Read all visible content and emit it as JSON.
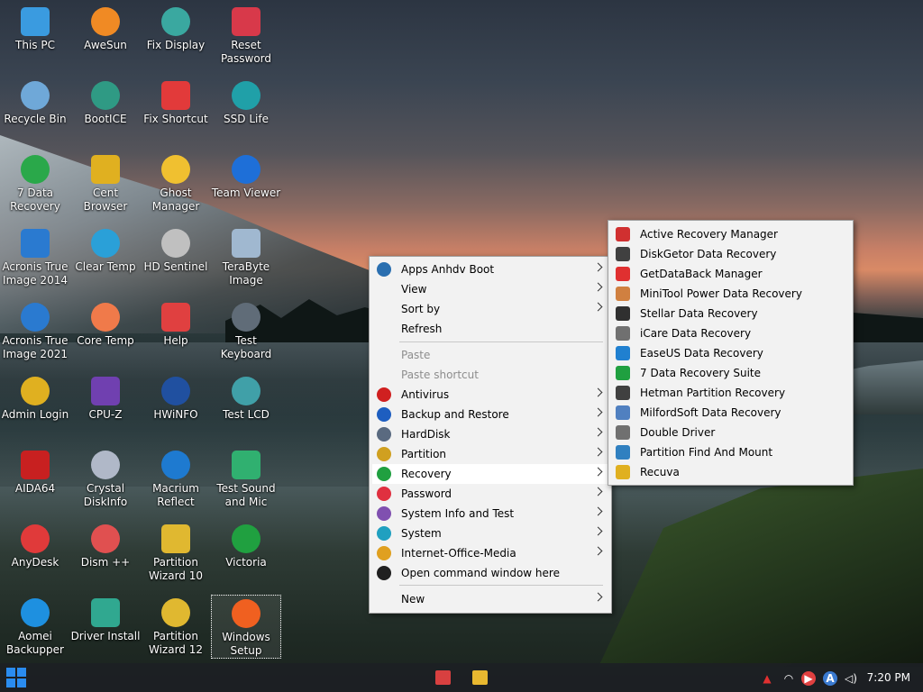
{
  "desktop": {
    "icons": [
      {
        "label": "This PC",
        "icon": "computer-icon",
        "color": "#3a9be0"
      },
      {
        "label": "AweSun",
        "icon": "awesun-icon",
        "color": "#f08a24"
      },
      {
        "label": "Fix Display",
        "icon": "fix-display-icon",
        "color": "#3aa8a0"
      },
      {
        "label": "Reset Password",
        "icon": "key-icon",
        "color": "#d8394a"
      },
      {
        "label": "Recycle Bin",
        "icon": "recycle-bin-icon",
        "color": "#6fa8d8"
      },
      {
        "label": "BootICE",
        "icon": "bootice-icon",
        "color": "#2f9a84"
      },
      {
        "label": "Fix Shortcut",
        "icon": "close-icon",
        "color": "#e23a3a"
      },
      {
        "label": "SSD Life",
        "icon": "ssd-icon",
        "color": "#20a0a8"
      },
      {
        "label": "7 Data Recovery",
        "icon": "recovery-icon",
        "color": "#2aa84a"
      },
      {
        "label": "Cent Browser",
        "icon": "browser-icon",
        "color": "#e0b020"
      },
      {
        "label": "Ghost Manager",
        "icon": "ghost-icon",
        "color": "#f0c030"
      },
      {
        "label": "Team Viewer",
        "icon": "teamviewer-icon",
        "color": "#1e6fd8"
      },
      {
        "label": "Acronis True Image 2014",
        "icon": "acronis-icon",
        "color": "#2a7ad0"
      },
      {
        "label": "Clear Temp",
        "icon": "broom-icon",
        "color": "#2aa0d8"
      },
      {
        "label": "HD Sentinel",
        "icon": "hdd-icon",
        "color": "#c0c0c0"
      },
      {
        "label": "TeraByte Image",
        "icon": "terabyte-icon",
        "color": "#a0b8d0"
      },
      {
        "label": "Acronis True Image 2021",
        "icon": "acronis-icon",
        "color": "#2a7ad0"
      },
      {
        "label": "Core Temp",
        "icon": "thermometer-icon",
        "color": "#f07a4a"
      },
      {
        "label": "Help",
        "icon": "lifebuoy-icon",
        "color": "#e04040"
      },
      {
        "label": "Test Keyboard",
        "icon": "keyboard-icon",
        "color": "#606c78"
      },
      {
        "label": "Admin Login",
        "icon": "shield-icon",
        "color": "#e0b020"
      },
      {
        "label": "CPU-Z",
        "icon": "cpu-icon",
        "color": "#7040b0"
      },
      {
        "label": "HWiNFO",
        "icon": "hwinfo-icon",
        "color": "#2050a0"
      },
      {
        "label": "Test LCD",
        "icon": "monitor-icon",
        "color": "#40a0a8"
      },
      {
        "label": "AIDA64",
        "icon": "aida-icon",
        "color": "#c82020"
      },
      {
        "label": "Crystal DiskInfo",
        "icon": "disk-icon",
        "color": "#b0b8c8"
      },
      {
        "label": "Macrium Reflect",
        "icon": "macrium-icon",
        "color": "#1e7ad0"
      },
      {
        "label": "Test Sound and Mic",
        "icon": "speaker-icon",
        "color": "#30b070"
      },
      {
        "label": "AnyDesk",
        "icon": "anydesk-icon",
        "color": "#e03a3a"
      },
      {
        "label": "Dism ++",
        "icon": "gear-icon",
        "color": "#e05050"
      },
      {
        "label": "Partition Wizard 10",
        "icon": "partition-icon",
        "color": "#e0b830"
      },
      {
        "label": "Victoria",
        "icon": "cross-icon",
        "color": "#20a040"
      },
      {
        "label": "Aomei Backupper",
        "icon": "backup-icon",
        "color": "#1e90e0"
      },
      {
        "label": "Driver Install",
        "icon": "wifi-icon",
        "color": "#30a890"
      },
      {
        "label": "Partition Wizard 12",
        "icon": "partition-icon",
        "color": "#e0b830"
      },
      {
        "label": "Windows Setup",
        "icon": "windows-icon",
        "color": "#f06020"
      }
    ]
  },
  "context_menu": {
    "items": [
      {
        "label": "Apps Anhdv Boot",
        "icon": "apps-icon",
        "color": "#2a6fb0",
        "arrow": true
      },
      {
        "label": "View",
        "icon": "",
        "arrow": true
      },
      {
        "label": "Sort by",
        "icon": "",
        "arrow": true
      },
      {
        "label": "Refresh",
        "icon": "",
        "arrow": false
      },
      {
        "label": "Paste",
        "icon": "",
        "arrow": false,
        "disabled": true
      },
      {
        "label": "Paste shortcut",
        "icon": "",
        "arrow": false,
        "disabled": true
      },
      {
        "label": "Antivirus",
        "icon": "antivirus-icon",
        "color": "#d02020",
        "arrow": true
      },
      {
        "label": "Backup and Restore",
        "icon": "backup-icon",
        "color": "#1e5ec0",
        "arrow": true
      },
      {
        "label": "HardDisk",
        "icon": "hdd-icon",
        "color": "#5a6a80",
        "arrow": true
      },
      {
        "label": "Partition",
        "icon": "partition-icon",
        "color": "#d0a020",
        "arrow": true
      },
      {
        "label": "Recovery",
        "icon": "recovery-icon",
        "color": "#20a040",
        "arrow": true
      },
      {
        "label": "Password",
        "icon": "key-icon",
        "color": "#e03040",
        "arrow": true
      },
      {
        "label": "System Info and Test",
        "icon": "system-info-icon",
        "color": "#8050b0",
        "arrow": true
      },
      {
        "label": "System",
        "icon": "system-icon",
        "color": "#20a0c0",
        "arrow": true
      },
      {
        "label": "Internet-Office-Media",
        "icon": "browser-icon",
        "color": "#e0a020",
        "arrow": true
      },
      {
        "label": "Open command window here",
        "icon": "cmd-icon",
        "color": "#202020",
        "arrow": false
      },
      {
        "label": "New",
        "icon": "",
        "arrow": true
      }
    ]
  },
  "submenu": {
    "items": [
      {
        "label": "Active Recovery Manager",
        "icon": "active-icon",
        "color": "#d03030"
      },
      {
        "label": "DiskGetor Data Recovery",
        "icon": "diskgetor-icon",
        "color": "#404040"
      },
      {
        "label": "GetDataBack Manager",
        "icon": "lifebuoy-icon",
        "color": "#e03030"
      },
      {
        "label": "MiniTool Power Data Recovery",
        "icon": "minitool-icon",
        "color": "#d08040"
      },
      {
        "label": "Stellar Data Recovery",
        "icon": "stellar-icon",
        "color": "#303030"
      },
      {
        "label": "iCare Data Recovery",
        "icon": "icare-icon",
        "color": "#707070"
      },
      {
        "label": "EaseUS Data Recovery",
        "icon": "easeus-icon",
        "color": "#2080d0"
      },
      {
        "label": "7 Data Recovery Suite",
        "icon": "recovery-icon",
        "color": "#20a040"
      },
      {
        "label": "Hetman Partition Recovery",
        "icon": "hetman-icon",
        "color": "#404040"
      },
      {
        "label": "MilfordSoft Data Recovery",
        "icon": "milford-icon",
        "color": "#5080c0"
      },
      {
        "label": "Double Driver",
        "icon": "double-driver-icon",
        "color": "#707070"
      },
      {
        "label": "Partition Find And Mount",
        "icon": "partition-find-icon",
        "color": "#3080c0"
      },
      {
        "label": "Recuva",
        "icon": "recuva-icon",
        "color": "#e0b020"
      }
    ]
  },
  "taskbar": {
    "clock": "7:20 PM",
    "tray_icons": [
      "anydesk-tray-icon",
      "network-icon",
      "media-icon",
      "apps-tray-icon",
      "volume-icon"
    ]
  }
}
